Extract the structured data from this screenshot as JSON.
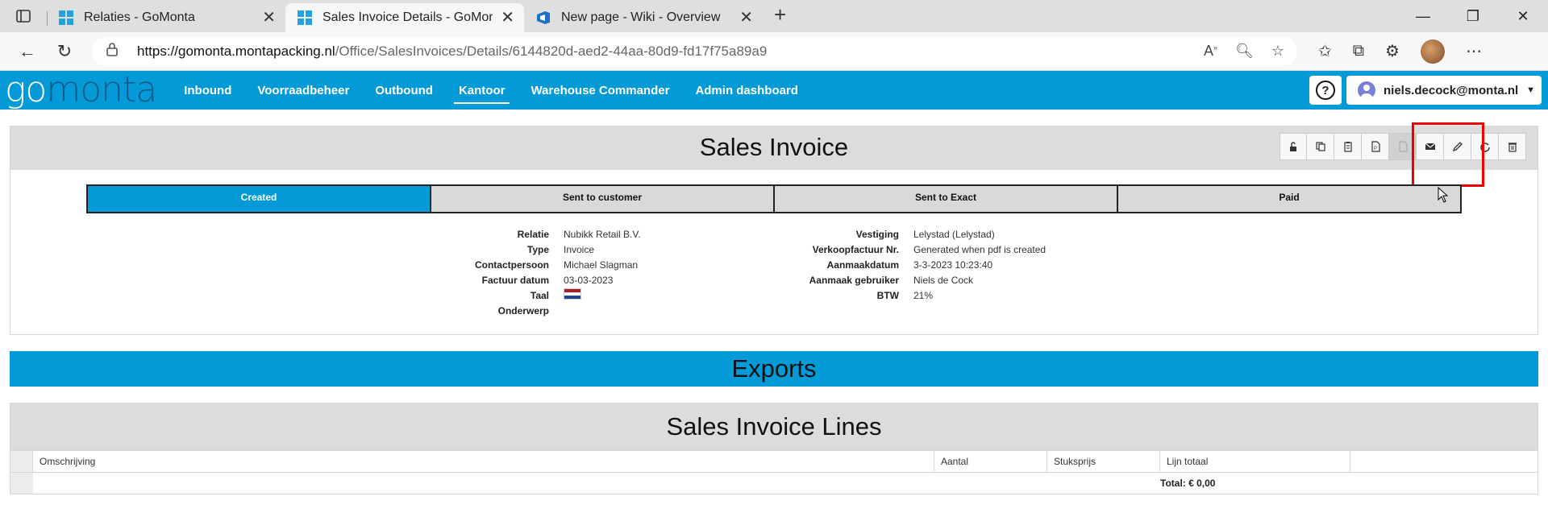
{
  "browser": {
    "tabs": [
      {
        "title": "Relaties - GoMonta",
        "active": false
      },
      {
        "title": "Sales Invoice Details - GoMonta",
        "active": true
      },
      {
        "title": "New page - Wiki - Overview",
        "active": false
      }
    ],
    "url_host": "https://gomonta.montapacking.nl",
    "url_path": "/Office/SalesInvoices/Details/6144820d-aed2-44aa-80d9-fd17f75a89a9"
  },
  "app": {
    "logo_go": "go",
    "logo_monta": "monta",
    "menu": [
      {
        "label": "Inbound"
      },
      {
        "label": "Voorraadbeheer"
      },
      {
        "label": "Outbound"
      },
      {
        "label": "Kantoor",
        "active": true
      },
      {
        "label": "Warehouse Commander"
      },
      {
        "label": "Admin dashboard"
      }
    ],
    "help": "?",
    "user": "niels.decock@monta.nl"
  },
  "invoice": {
    "title": "Sales Invoice",
    "toolbar_icons": [
      "unlock-icon",
      "copy-icon",
      "clipboard-icon",
      "pdf-icon",
      "pdf-disabled-icon",
      "mail-icon",
      "edit-icon",
      "refresh-icon",
      "delete-icon"
    ],
    "steps": [
      {
        "label": "Created",
        "active": true
      },
      {
        "label": "Sent to customer"
      },
      {
        "label": "Sent to Exact"
      },
      {
        "label": "Paid"
      }
    ],
    "left_fields": [
      {
        "label": "Relatie",
        "value": "Nubikk Retail B.V."
      },
      {
        "label": "Type",
        "value": "Invoice"
      },
      {
        "label": "Contactpersoon",
        "value": "Michael Slagman"
      },
      {
        "label": "Factuur datum",
        "value": "03-03-2023"
      },
      {
        "label": "Taal",
        "value": ""
      },
      {
        "label": "Onderwerp",
        "value": ""
      }
    ],
    "right_fields": [
      {
        "label": "Vestiging",
        "value": "Lelystad (Lelystad)"
      },
      {
        "label": "Verkoopfactuur Nr.",
        "value": "Generated when pdf is created"
      },
      {
        "label": "Aanmaakdatum",
        "value": "3-3-2023 10:23:40"
      },
      {
        "label": "Aanmaak gebruiker",
        "value": "Niels de Cock"
      },
      {
        "label": "BTW",
        "value": "21%"
      }
    ]
  },
  "exports": {
    "title": "Exports"
  },
  "lines": {
    "title": "Sales Invoice Lines",
    "columns": [
      "Omschrijving",
      "Aantal",
      "Stuksprijs",
      "Lijn totaal"
    ],
    "total": "Total: € 0,00"
  },
  "colors": {
    "brand": "#049ad8",
    "highlight": "#e00000"
  }
}
